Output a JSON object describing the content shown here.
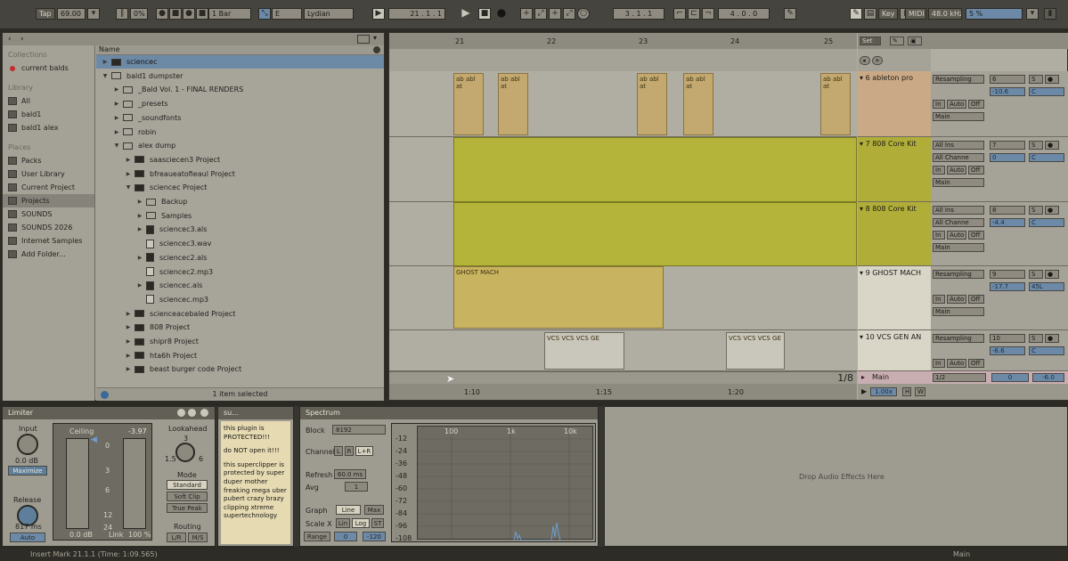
{
  "transport": {
    "tap": "Tap",
    "bpm": "69.00",
    "zoom_pct": "0%",
    "swing": "0%",
    "quantize": "1 Bar",
    "key_root": "E",
    "scale": "Lydian",
    "position": "21 . 1 . 1",
    "loop_start": "3 . 1 . 1",
    "loop_length": "4 . 0 . 0",
    "key_btn": "Key",
    "midi_btn": "MIDI",
    "sample_rate": "48.0 kHz",
    "cpu": "5 %"
  },
  "browser": {
    "collections_header": "Collections",
    "collections": [
      "current balds"
    ],
    "library_header": "Library",
    "library": [
      "All",
      "bald1",
      "bald1 alex"
    ],
    "places_header": "Places",
    "places": [
      "Packs",
      "User Library",
      "Current Project",
      "Projects",
      "SOUNDS",
      "SOUNDS 2026",
      "Internet Samples",
      "Add Folder..."
    ],
    "name_header": "Name",
    "files": [
      {
        "name": "sciencec",
        "indent": 0,
        "kind": "folder-dark",
        "open": false
      },
      {
        "name": "bald1 dumpster",
        "indent": 0,
        "kind": "folder",
        "open": true
      },
      {
        "name": "_Bald Vol. 1 - FINAL RENDERS",
        "indent": 1,
        "kind": "folder",
        "open": false
      },
      {
        "name": "_presets",
        "indent": 1,
        "kind": "folder",
        "open": false
      },
      {
        "name": "_soundfonts",
        "indent": 1,
        "kind": "folder",
        "open": false
      },
      {
        "name": "robin",
        "indent": 1,
        "kind": "folder",
        "open": false
      },
      {
        "name": "alex dump",
        "indent": 1,
        "kind": "folder",
        "open": true
      },
      {
        "name": "saasciecen3 Project",
        "indent": 2,
        "kind": "folder-dark",
        "open": false
      },
      {
        "name": "bfreaueatofieaul Project",
        "indent": 2,
        "kind": "folder-dark",
        "open": false
      },
      {
        "name": "sciencec Project",
        "indent": 2,
        "kind": "folder-dark",
        "open": true
      },
      {
        "name": "Backup",
        "indent": 3,
        "kind": "folder",
        "open": false
      },
      {
        "name": "Samples",
        "indent": 3,
        "kind": "folder",
        "open": false
      },
      {
        "name": "sciencec3.als",
        "indent": 3,
        "kind": "file-dark",
        "open": false
      },
      {
        "name": "sciencec3.wav",
        "indent": 3,
        "kind": "file",
        "open": null
      },
      {
        "name": "sciencec2.als",
        "indent": 3,
        "kind": "file-dark",
        "open": false
      },
      {
        "name": "sciencec2.mp3",
        "indent": 3,
        "kind": "file",
        "open": null
      },
      {
        "name": "sciencec.als",
        "indent": 3,
        "kind": "file-dark",
        "open": false
      },
      {
        "name": "sciencec.mp3",
        "indent": 3,
        "kind": "file",
        "open": null
      },
      {
        "name": "scienceacebaled Project",
        "indent": 2,
        "kind": "folder-dark",
        "open": false
      },
      {
        "name": "808 Project",
        "indent": 2,
        "kind": "folder-dark",
        "open": false
      },
      {
        "name": "shipr8 Project",
        "indent": 2,
        "kind": "folder-dark",
        "open": false
      },
      {
        "name": "hta6h Project",
        "indent": 2,
        "kind": "folder-dark",
        "open": false
      },
      {
        "name": "beast burger code Project",
        "indent": 2,
        "kind": "folder-dark",
        "open": false
      }
    ],
    "status": "1 item selected"
  },
  "arrangement": {
    "ruler": [
      "21",
      "22",
      "23",
      "24",
      "25"
    ],
    "bottom_ruler": [
      "1:10",
      "1:15",
      "1:20"
    ],
    "grid": "1/8",
    "set_btn": "Set",
    "zoom": "1.00x",
    "hw": [
      "H",
      "W"
    ],
    "drum_clip_label": "ab abl at",
    "ghost_clip_label": "GHOST MACH",
    "vcs_clip_label": "VCS VCS VCS GE",
    "tracks": [
      {
        "name": "6 ableton pro",
        "input": "Resampling",
        "monitor": [
          "In",
          "Auto",
          "Off"
        ],
        "out": "Main",
        "num": "6",
        "vol": "-10.6",
        "pan": "C",
        "color": "#caa986"
      },
      {
        "name": "7 808 Core Kit",
        "input": "All Ins",
        "channel": "All Channe",
        "monitor": [
          "In",
          "Auto",
          "Off"
        ],
        "out": "Main",
        "num": "7",
        "vol": "0",
        "pan": "C",
        "color": "#b0ad38"
      },
      {
        "name": "8 808 Core Kit",
        "input": "All Ins",
        "channel": "All Channe",
        "monitor": [
          "In",
          "Auto",
          "Off"
        ],
        "out": "Main",
        "num": "8",
        "vol": "-4.4",
        "pan": "C",
        "color": "#b0ad38"
      },
      {
        "name": "9 GHOST MACH",
        "input": "Resampling",
        "monitor": [
          "In",
          "Auto",
          "Off"
        ],
        "out": "Main",
        "num": "9",
        "vol": "-17.7",
        "pan": "45L",
        "color": "#d9d5c7"
      },
      {
        "name": "10 VCS GEN AN",
        "input": "Resampling",
        "monitor": [
          "In",
          "Auto",
          "Off"
        ],
        "out": "Main",
        "num": "10",
        "vol": "-6.6",
        "pan": "C",
        "color": "#d9d5c7"
      }
    ],
    "main": {
      "name": "Main",
      "quant": "1/2",
      "vol": "0",
      "pan": "-6.0"
    }
  },
  "devices": {
    "limiter": {
      "title": "Limiter",
      "input_label": "Input",
      "input_val": "0.0 dB",
      "maximize": "Maximize",
      "release_label": "Release",
      "release_val": "817 ms",
      "auto": "Auto",
      "ceiling_label": "Ceiling",
      "ceiling_val": "-3.97",
      "scale": [
        "0",
        "3",
        "6",
        "12",
        "24"
      ],
      "ceiling_db": "0.0 dB",
      "link": "Link",
      "link_val": "100 %",
      "lookahead_label": "Lookahead",
      "lookahead_vals": [
        "3",
        "1.5",
        "6"
      ],
      "mode_label": "Mode",
      "modes": [
        "Standard",
        "Soft Clip",
        "True Peak"
      ],
      "routing_label": "Routing",
      "routing": [
        "L/R",
        "M/S"
      ]
    },
    "note": {
      "title": "su...",
      "text": [
        "this plugin is PROTECTED!!!",
        "do NOT open it!!!",
        "this superclipper is protected by super duper mother freaking mega uber pubert crazy brazy clipping xtreme supertechnology"
      ]
    },
    "spectrum": {
      "title": "Spectrum",
      "block_label": "Block",
      "block_val": "8192",
      "channel_label": "Channel",
      "channels": [
        "L",
        "R",
        "L+R"
      ],
      "refresh_label": "Refresh",
      "refresh_val": "60.0 ms",
      "avg_label": "Avg",
      "avg_val": "1",
      "graph_label": "Graph",
      "graph_opts": [
        "Line",
        "Max"
      ],
      "scalex_label": "Scale X",
      "scalex_opts": [
        "Lin",
        "Log",
        "ST"
      ],
      "range_label": "Range",
      "range_vals": [
        "0",
        "-120"
      ],
      "db_scale": [
        "-12",
        "-24",
        "-36",
        "-48",
        "-60",
        "-72",
        "-84",
        "-96",
        "-108"
      ],
      "freq_scale": [
        "100",
        "1k",
        "10k"
      ]
    },
    "drop_text": "Drop Audio Effects Here"
  },
  "statusbar": {
    "text": "Insert Mark 21.1.1 (Time: 1:09.565)",
    "main": "Main"
  }
}
